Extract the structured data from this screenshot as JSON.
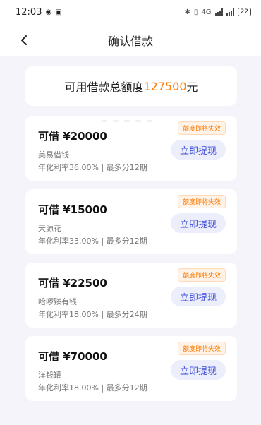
{
  "status_bar": {
    "time": "12:03",
    "network": "4G",
    "battery": "22"
  },
  "nav": {
    "title": "确认借款"
  },
  "summary": {
    "prefix": "可用借款总额度",
    "amount": "127500",
    "suffix": "元"
  },
  "loans": [
    {
      "amount": "可借 ¥20000",
      "name": "美易借钱",
      "info": "年化利率36.00% | 最多分12期",
      "badge": "额度即将失效",
      "button": "立即提现"
    },
    {
      "amount": "可借 ¥15000",
      "name": "天源花",
      "info": "年化利率33.00% | 最多分12期",
      "badge": "额度即将失效",
      "button": "立即提现"
    },
    {
      "amount": "可借 ¥22500",
      "name": "哈啰臻有钱",
      "info": "年化利率18.00% | 最多分24期",
      "badge": "额度即将失效",
      "button": "立即提现"
    },
    {
      "amount": "可借 ¥70000",
      "name": "洋钱罐",
      "info": "年化利率18.00% | 最多分12期",
      "badge": "额度即将失效",
      "button": "立即提现"
    }
  ],
  "colors": {
    "accent": "#ff7a00",
    "button_text": "#3c4ad8",
    "button_bg": "#eceffb",
    "page_bg": "#f4f4fa"
  }
}
